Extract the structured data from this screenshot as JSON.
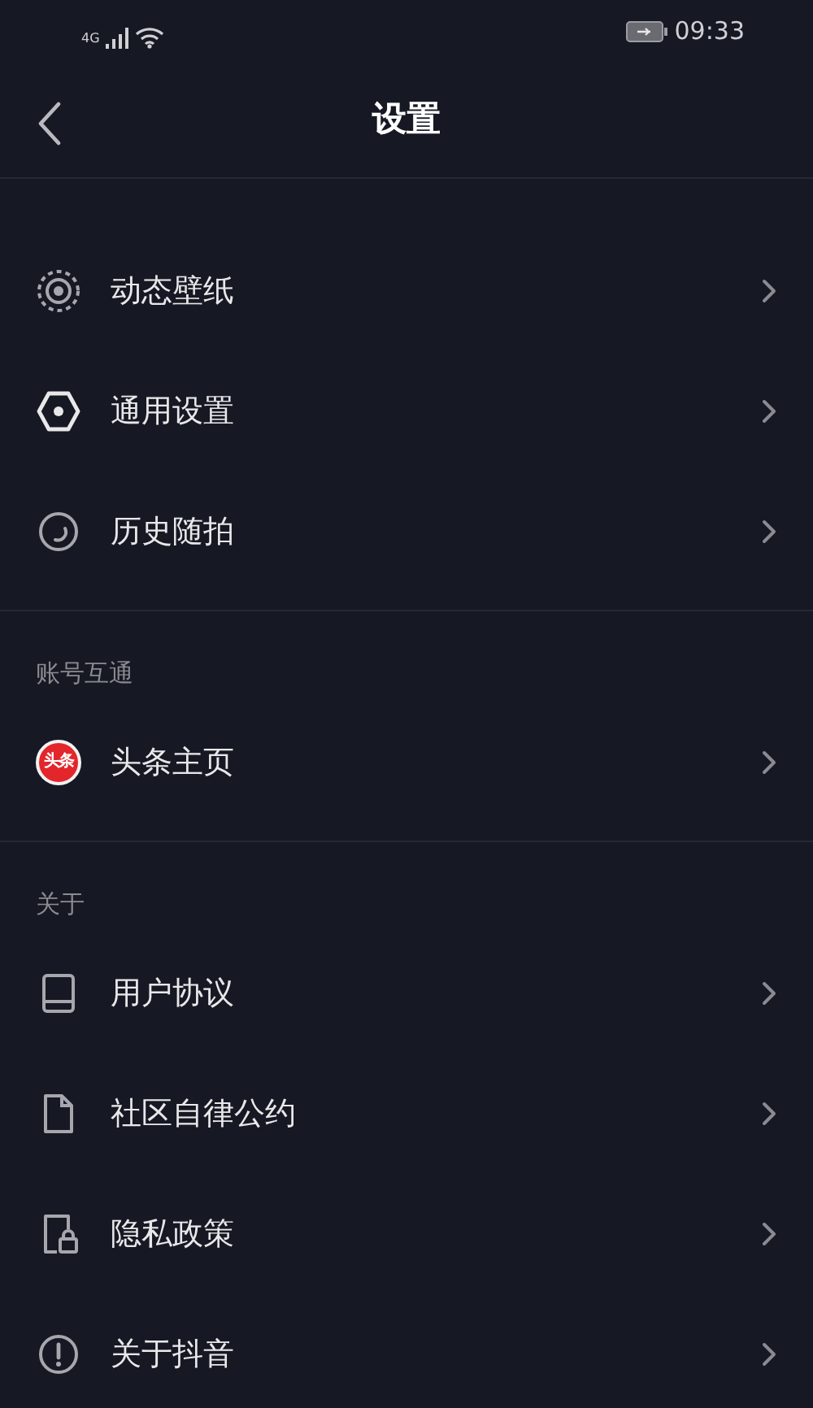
{
  "status_bar": {
    "network": "4G",
    "time": "09:33"
  },
  "header": {
    "title": "设置"
  },
  "sections": [
    {
      "items": [
        {
          "kind": "wallpaper",
          "label": "动态壁纸"
        },
        {
          "kind": "hexagon",
          "label": "通用设置"
        },
        {
          "kind": "history",
          "label": "历史随拍"
        }
      ]
    },
    {
      "title": "账号互通",
      "items": [
        {
          "kind": "toutiao",
          "badge": "头条",
          "label": "头条主页"
        }
      ]
    },
    {
      "title": "关于",
      "items": [
        {
          "kind": "book",
          "label": "用户协议"
        },
        {
          "kind": "document",
          "label": "社区自律公约"
        },
        {
          "kind": "lock",
          "label": "隐私政策"
        },
        {
          "kind": "info",
          "label": "关于抖音"
        }
      ]
    }
  ]
}
